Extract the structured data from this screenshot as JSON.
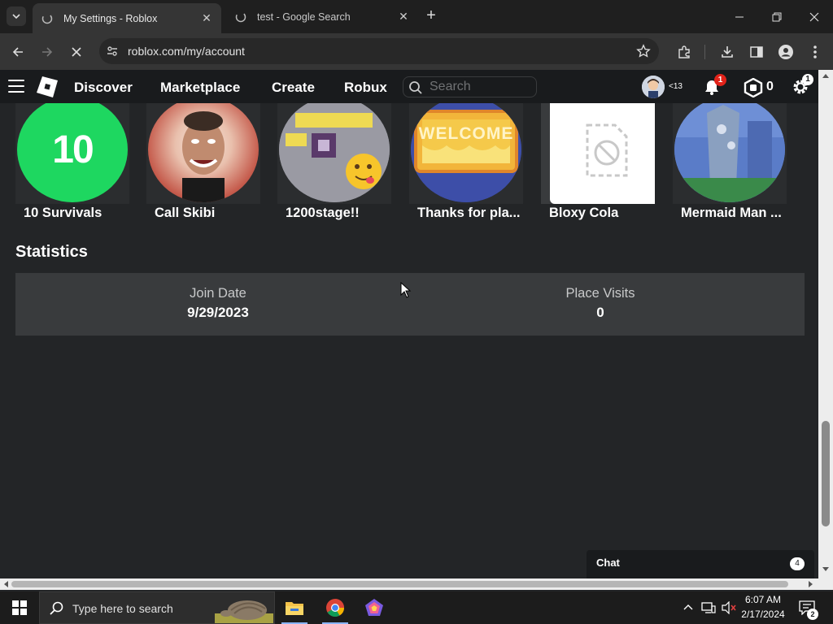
{
  "browser": {
    "tabs": [
      {
        "title": "My Settings - Roblox",
        "active": true
      },
      {
        "title": "test - Google Search",
        "active": false
      }
    ],
    "url": "roblox.com/my/account"
  },
  "header": {
    "nav": [
      "Discover",
      "Marketplace",
      "Create",
      "Robux"
    ],
    "search_placeholder": "Search",
    "age_label": "<13",
    "notifications_count": "1",
    "robux_count": "0",
    "settings_badge": "1"
  },
  "games": [
    {
      "name": "10 Survivals",
      "thumb_text": "10"
    },
    {
      "name": "Call Skibi"
    },
    {
      "name": "1200stage!!"
    },
    {
      "name": "Thanks for pla...",
      "thumb_text": "WELCOME"
    },
    {
      "name": "Bloxy Cola"
    },
    {
      "name": "Mermaid Man ..."
    }
  ],
  "statistics": {
    "title": "Statistics",
    "join_date_label": "Join Date",
    "join_date_value": "9/29/2023",
    "place_visits_label": "Place Visits",
    "place_visits_value": "0"
  },
  "chat": {
    "label": "Chat",
    "count": "4"
  },
  "taskbar": {
    "search_placeholder": "Type here to search",
    "time": "6:07 AM",
    "date": "2/17/2024",
    "notifications": "2"
  },
  "colors": {
    "page_bg": "#232527",
    "header_bg": "#191b1d",
    "stats_bg": "#393b3d",
    "accent_green": "#1ed760"
  }
}
